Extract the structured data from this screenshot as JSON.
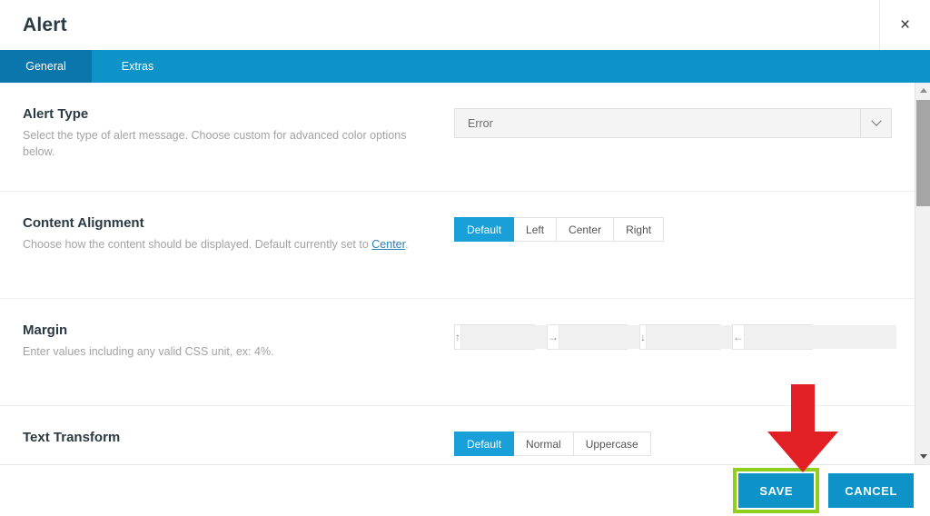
{
  "header": {
    "title": "Alert",
    "close_label": "×"
  },
  "tabs": [
    {
      "label": "General",
      "active": true
    },
    {
      "label": "Extras",
      "active": false
    }
  ],
  "fields": [
    {
      "id": "alert-type",
      "title": "Alert Type",
      "description": "Select the type of alert message. Choose custom for advanced color options below.",
      "control": "select",
      "value": "Error"
    },
    {
      "id": "content-alignment",
      "title": "Content Alignment",
      "description_pre": "Choose how the content should be displayed. Default currently set to ",
      "description_link": "Center",
      "description_post": ".",
      "control": "buttongroup",
      "options": [
        "Default",
        "Left",
        "Center",
        "Right"
      ],
      "selected": "Default"
    },
    {
      "id": "margin",
      "title": "Margin",
      "description": "Enter values including any valid CSS unit, ex: 4%.",
      "control": "margin",
      "inputs": [
        {
          "icon": "arrow-up",
          "glyph": "↑",
          "value": ""
        },
        {
          "icon": "arrow-right",
          "glyph": "→",
          "value": ""
        },
        {
          "icon": "arrow-down",
          "glyph": "↓",
          "value": ""
        },
        {
          "icon": "arrow-left",
          "glyph": "←",
          "value": ""
        }
      ]
    },
    {
      "id": "text-transform",
      "title": "Text Transform",
      "description": "",
      "control": "buttongroup",
      "options": [
        "Default",
        "Normal",
        "Uppercase"
      ],
      "selected": "Default"
    }
  ],
  "footer": {
    "save_label": "SAVE",
    "cancel_label": "CANCEL"
  },
  "annotation": {
    "arrow": "red-down-arrow-pointing-to-save",
    "highlight": "green-box-around-save-button"
  },
  "colors": {
    "tabbar_blue": "#0d93c8",
    "tab_active_blue": "#0b76ab",
    "button_blue": "#19a0d8",
    "footer_blue": "#0d93c8",
    "highlight_green": "#8fd01e",
    "annotation_red": "#e31f26",
    "link_blue": "#2a7fb8",
    "title_color": "#2b3a42",
    "desc_color": "#a3a3a3"
  }
}
